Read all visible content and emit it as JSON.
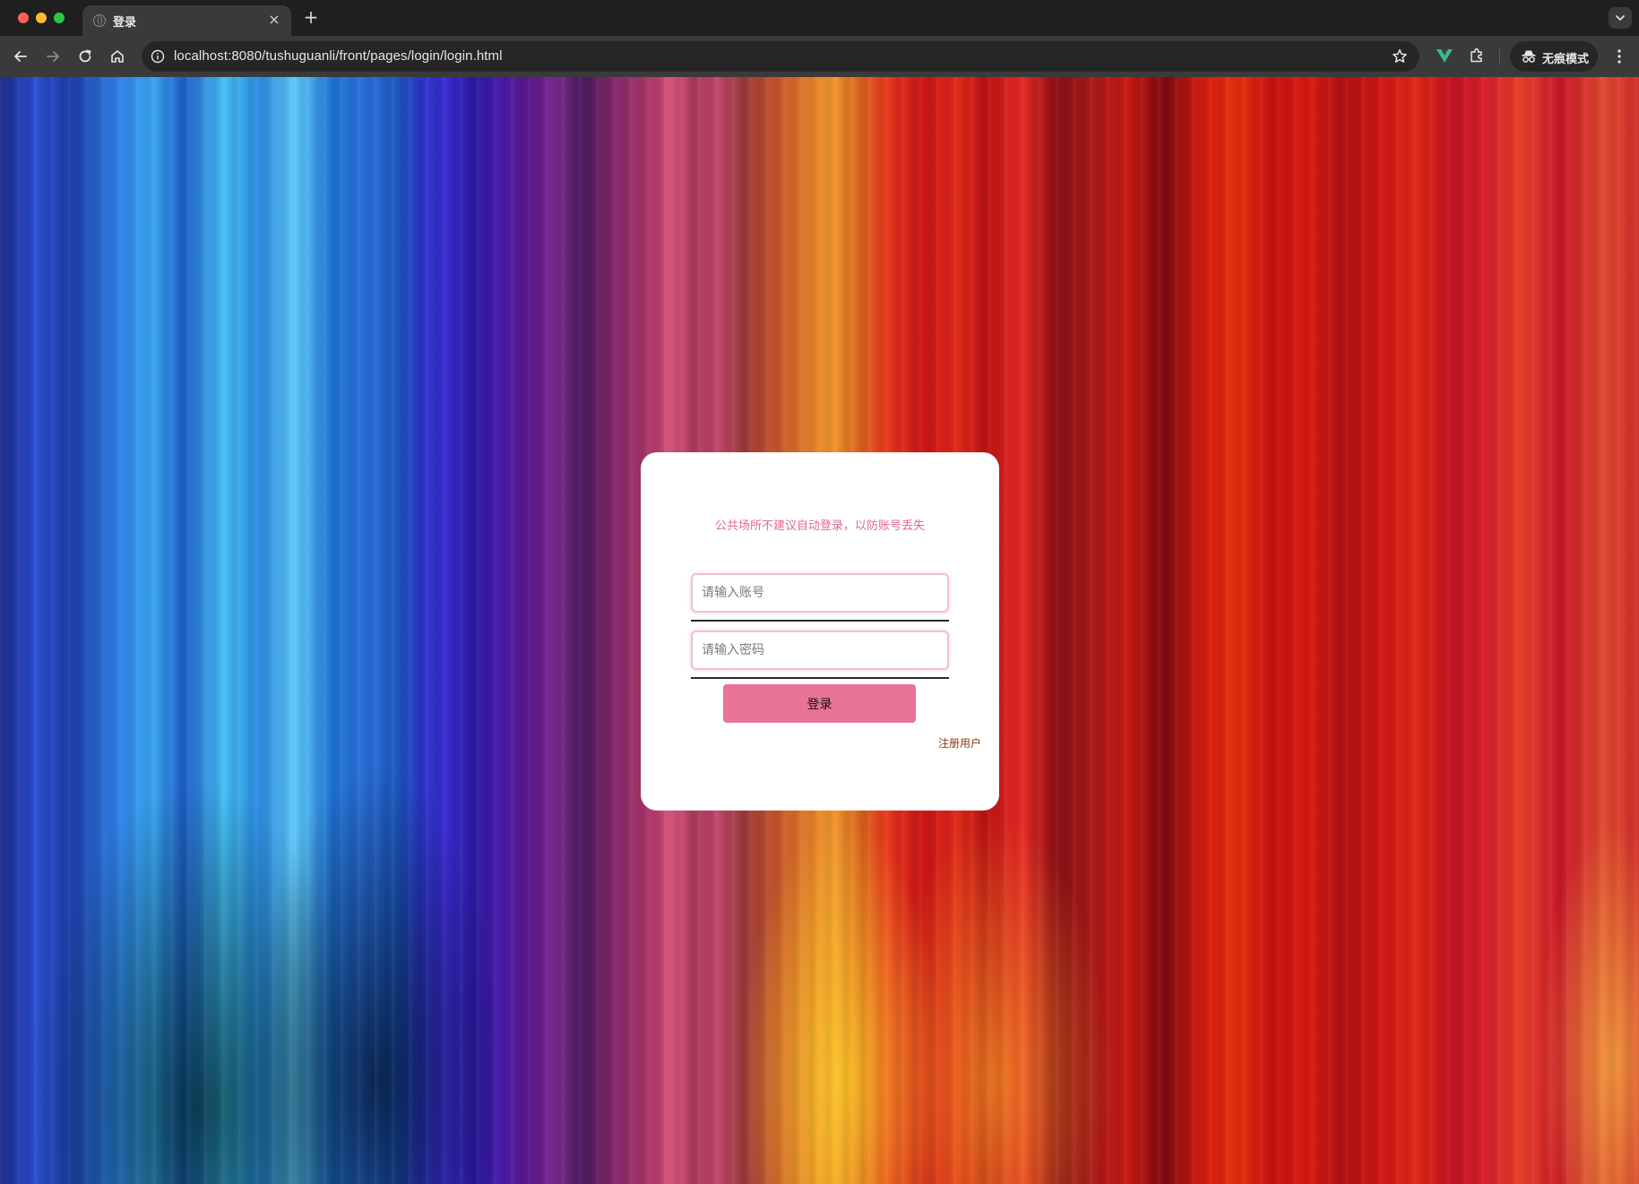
{
  "browser": {
    "tab": {
      "title": "登录",
      "close_glyph": "×"
    },
    "new_tab_glyph": "+",
    "address": {
      "url": "localhost:8080/tushuguanli/front/pages/login/login.html"
    },
    "incognito_label": "无痕模式",
    "icons": {
      "back": "arrow-left-icon",
      "forward": "arrow-right-icon",
      "reload": "reload-icon",
      "home": "home-icon",
      "info": "info-icon",
      "bookmark": "star-icon",
      "extension_vue": "vue-devtools-icon",
      "extensions": "puzzle-icon",
      "incognito": "incognito-icon",
      "menu": "kebab-menu-icon",
      "tab_dropdown": "chevron-down-icon"
    }
  },
  "login": {
    "notice": "公共场所不建议自动登录，以防账号丢失",
    "account_placeholder": "请输入账号",
    "password_placeholder": "请输入密码",
    "account_value": "",
    "password_value": "",
    "login_button": "登录",
    "register_link": "注册用户"
  },
  "colors": {
    "accent_pink": "#e77494",
    "notice_pink": "#e06a8e",
    "register_brown": "#8a3a10",
    "field_border": "#f0bfd0"
  }
}
